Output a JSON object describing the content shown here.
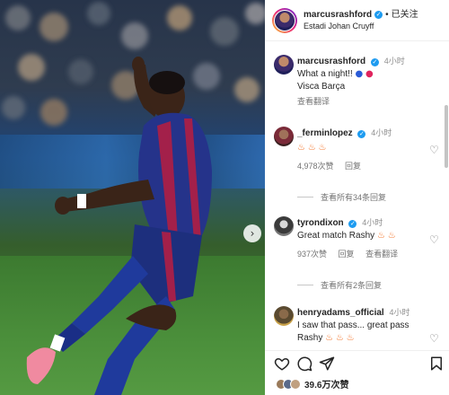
{
  "header": {
    "username": "marcusrashford",
    "separator": "•",
    "follow_label": "已关注",
    "location": "Estadi Johan Cruyff"
  },
  "comments": [
    {
      "username": "marcusrashford",
      "time": "4小时",
      "lines": [
        "What a night!!",
        "Visca Barça"
      ],
      "line1_emojis": [
        "blue-circle",
        "red-circle"
      ],
      "translate_label": "查看翻译"
    },
    {
      "username": "_ferminlopez",
      "time": "4小时",
      "text_emojis": [
        "fire",
        "fire",
        "fire"
      ],
      "likes": "4,978次赞",
      "reply_label": "回复",
      "view_replies": "查看所有34条回复"
    },
    {
      "username": "tyrondixon",
      "time": "4小时",
      "text": "Great match Rashy",
      "text_emojis": [
        "fire",
        "fire"
      ],
      "likes": "937次赞",
      "reply_label": "回复",
      "translate_label": "查看翻译",
      "view_replies": "查看所有2条回复"
    },
    {
      "username": "henryadams_official",
      "time": "4小时",
      "text": "I saw that pass... great pass",
      "text2": "Rashy",
      "text_emojis": [
        "fire",
        "fire",
        "fire"
      ]
    }
  ],
  "footer": {
    "likes_count": "39.6万次赞",
    "icons": [
      "heart-icon",
      "comment-icon",
      "share-icon",
      "bookmark-icon"
    ]
  },
  "colors": {
    "verified": "#1d9bf0",
    "muted": "#737373",
    "story_ring": [
      "#f9ce34",
      "#ee2a7b",
      "#6228d7"
    ]
  }
}
